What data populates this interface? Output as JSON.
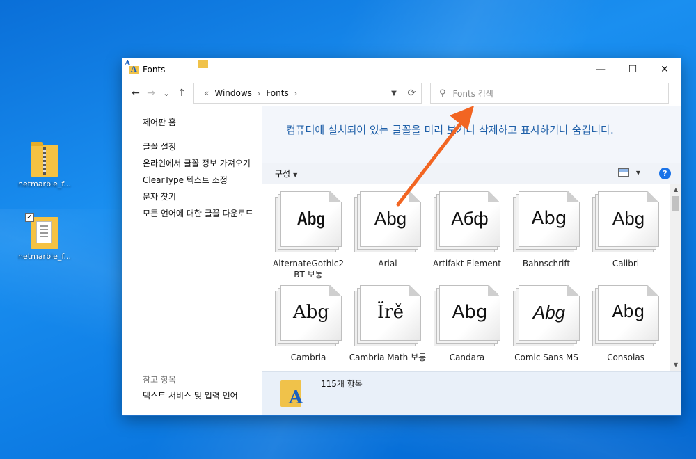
{
  "desktop": {
    "icons": [
      {
        "label": "netmarble_f...",
        "icon": "zip-folder-icon"
      },
      {
        "label": "netmarble_f...",
        "icon": "folder-icon"
      }
    ]
  },
  "window": {
    "title": "Fonts",
    "controls": {
      "minimize": "—",
      "maximize": "☐",
      "close": "✕"
    },
    "nav": {
      "back": "←",
      "forward": "→",
      "recent": "⌄",
      "up": "↑"
    },
    "address": {
      "prefix": "«",
      "crumbs": [
        "Windows",
        "Fonts"
      ],
      "sep": "›"
    },
    "search": {
      "placeholder": "Fonts 검색"
    },
    "sidebar": {
      "home": "제어판 홈",
      "links": [
        "글꼴 설정",
        "온라인에서 글꼴 정보 가져오기",
        "ClearType 텍스트 조정",
        "문자 찾기",
        "모든 언어에 대한 글꼴 다운로드"
      ],
      "see_also": "참고 항목",
      "see_also_link": "텍스트 서비스 및 입력 언어"
    },
    "heading": "컴퓨터에 설치되어 있는 글꼴을 미리 보거나 삭제하고 표시하거나 숨깁니다.",
    "toolbar": {
      "organize": "구성",
      "help": "?"
    },
    "fonts": [
      {
        "sample": "Abg",
        "name": "AlternateGothic2 BT 보통",
        "style": "f-cond"
      },
      {
        "sample": "Abg",
        "name": "Arial",
        "style": "f-sans"
      },
      {
        "sample": "Абф",
        "name": "Artifakt Element",
        "style": "f-sans"
      },
      {
        "sample": "Abg",
        "name": "Bahnschrift",
        "style": "f-dsans"
      },
      {
        "sample": "Abg",
        "name": "Calibri",
        "style": "f-sans"
      },
      {
        "sample": "Abg",
        "name": "Cambria",
        "style": "f-serif"
      },
      {
        "sample": "Ïrě",
        "name": "Cambria Math 보통",
        "style": "f-serif"
      },
      {
        "sample": "Abg",
        "name": "Candara",
        "style": "f-dsans"
      },
      {
        "sample": "Abg",
        "name": "Comic Sans MS",
        "style": "f-ital"
      },
      {
        "sample": "Abg",
        "name": "Consolas",
        "style": "f-mono"
      }
    ],
    "status": {
      "count": "115개 항목"
    }
  },
  "colors": {
    "accent": "#1e5fa8",
    "arrow": "#f26522",
    "desktop": "#0a78e0"
  }
}
